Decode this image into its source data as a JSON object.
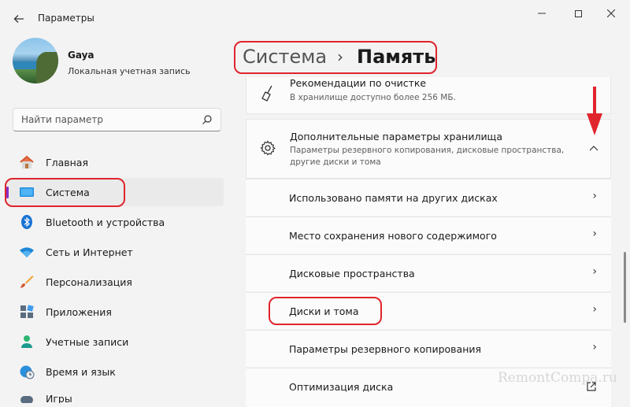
{
  "window": {
    "title": "Параметры"
  },
  "user": {
    "name": "Gaya",
    "account_type": "Локальная учетная запись"
  },
  "search": {
    "placeholder": "Найти параметр"
  },
  "sidebar": {
    "items": [
      {
        "label": "Главная",
        "icon": "home-icon"
      },
      {
        "label": "Система",
        "icon": "system-icon",
        "active": true
      },
      {
        "label": "Bluetooth и устройства",
        "icon": "bluetooth-icon"
      },
      {
        "label": "Сеть и Интернет",
        "icon": "wifi-icon"
      },
      {
        "label": "Персонализация",
        "icon": "brush-icon"
      },
      {
        "label": "Приложения",
        "icon": "apps-icon"
      },
      {
        "label": "Учетные записи",
        "icon": "person-icon"
      },
      {
        "label": "Время и язык",
        "icon": "clock-globe-icon"
      },
      {
        "label": "Игры",
        "icon": "gamepad-icon"
      }
    ]
  },
  "header": {
    "breadcrumb_parent": "Система",
    "breadcrumb_separator": "›",
    "breadcrumb_current": "Память"
  },
  "content": {
    "cleanup": {
      "title": "Рекомендации по очистке",
      "subtitle": "В хранилище доступно более 256 МБ."
    },
    "advanced": {
      "title": "Дополнительные параметры хранилища",
      "subtitle_line1": "Параметры резервного копирования, дисковые пространства,",
      "subtitle_line2": "другие диски и тома"
    },
    "rows": [
      {
        "label": "Использовано памяти на других дисках"
      },
      {
        "label": "Место сохранения нового содержимого"
      },
      {
        "label": "Дисковые пространства"
      },
      {
        "label": "Диски и тома"
      },
      {
        "label": "Параметры резервного копирования"
      },
      {
        "label": "Оптимизация диска"
      }
    ]
  },
  "watermark": "RemontCompa.ru",
  "colors": {
    "accent": "#8b2bc5",
    "highlight_outline": "#e0242c",
    "system_icon": "#1f8fe0"
  }
}
